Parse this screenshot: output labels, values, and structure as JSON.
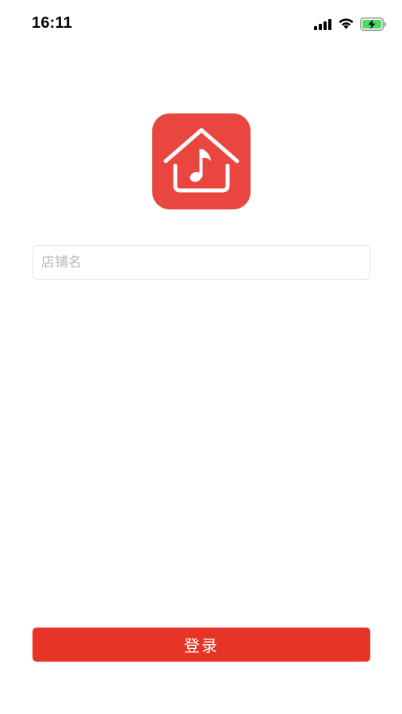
{
  "status_bar": {
    "time": "16:11",
    "icons": [
      "signal-icon",
      "wifi-icon",
      "battery-charging-icon"
    ],
    "battery_color": "#4cd964"
  },
  "logo": {
    "icon": "house-music-note-icon",
    "background": "#e8463f"
  },
  "login_form": {
    "shop_name": {
      "value": "",
      "placeholder": "店铺名"
    },
    "login_button_label": "登录",
    "accent_color": "#e63526"
  }
}
